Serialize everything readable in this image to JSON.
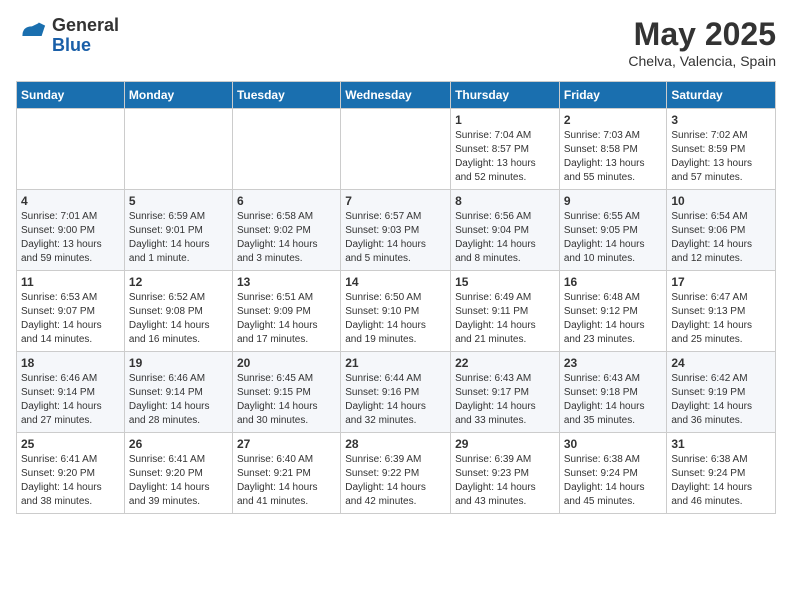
{
  "logo": {
    "general": "General",
    "blue": "Blue"
  },
  "title": "May 2025",
  "location": "Chelva, Valencia, Spain",
  "weekdays": [
    "Sunday",
    "Monday",
    "Tuesday",
    "Wednesday",
    "Thursday",
    "Friday",
    "Saturday"
  ],
  "weeks": [
    [
      {
        "day": "",
        "info": ""
      },
      {
        "day": "",
        "info": ""
      },
      {
        "day": "",
        "info": ""
      },
      {
        "day": "",
        "info": ""
      },
      {
        "day": "1",
        "info": "Sunrise: 7:04 AM\nSunset: 8:57 PM\nDaylight: 13 hours\nand 52 minutes."
      },
      {
        "day": "2",
        "info": "Sunrise: 7:03 AM\nSunset: 8:58 PM\nDaylight: 13 hours\nand 55 minutes."
      },
      {
        "day": "3",
        "info": "Sunrise: 7:02 AM\nSunset: 8:59 PM\nDaylight: 13 hours\nand 57 minutes."
      }
    ],
    [
      {
        "day": "4",
        "info": "Sunrise: 7:01 AM\nSunset: 9:00 PM\nDaylight: 13 hours\nand 59 minutes."
      },
      {
        "day": "5",
        "info": "Sunrise: 6:59 AM\nSunset: 9:01 PM\nDaylight: 14 hours\nand 1 minute."
      },
      {
        "day": "6",
        "info": "Sunrise: 6:58 AM\nSunset: 9:02 PM\nDaylight: 14 hours\nand 3 minutes."
      },
      {
        "day": "7",
        "info": "Sunrise: 6:57 AM\nSunset: 9:03 PM\nDaylight: 14 hours\nand 5 minutes."
      },
      {
        "day": "8",
        "info": "Sunrise: 6:56 AM\nSunset: 9:04 PM\nDaylight: 14 hours\nand 8 minutes."
      },
      {
        "day": "9",
        "info": "Sunrise: 6:55 AM\nSunset: 9:05 PM\nDaylight: 14 hours\nand 10 minutes."
      },
      {
        "day": "10",
        "info": "Sunrise: 6:54 AM\nSunset: 9:06 PM\nDaylight: 14 hours\nand 12 minutes."
      }
    ],
    [
      {
        "day": "11",
        "info": "Sunrise: 6:53 AM\nSunset: 9:07 PM\nDaylight: 14 hours\nand 14 minutes."
      },
      {
        "day": "12",
        "info": "Sunrise: 6:52 AM\nSunset: 9:08 PM\nDaylight: 14 hours\nand 16 minutes."
      },
      {
        "day": "13",
        "info": "Sunrise: 6:51 AM\nSunset: 9:09 PM\nDaylight: 14 hours\nand 17 minutes."
      },
      {
        "day": "14",
        "info": "Sunrise: 6:50 AM\nSunset: 9:10 PM\nDaylight: 14 hours\nand 19 minutes."
      },
      {
        "day": "15",
        "info": "Sunrise: 6:49 AM\nSunset: 9:11 PM\nDaylight: 14 hours\nand 21 minutes."
      },
      {
        "day": "16",
        "info": "Sunrise: 6:48 AM\nSunset: 9:12 PM\nDaylight: 14 hours\nand 23 minutes."
      },
      {
        "day": "17",
        "info": "Sunrise: 6:47 AM\nSunset: 9:13 PM\nDaylight: 14 hours\nand 25 minutes."
      }
    ],
    [
      {
        "day": "18",
        "info": "Sunrise: 6:46 AM\nSunset: 9:14 PM\nDaylight: 14 hours\nand 27 minutes."
      },
      {
        "day": "19",
        "info": "Sunrise: 6:46 AM\nSunset: 9:14 PM\nDaylight: 14 hours\nand 28 minutes."
      },
      {
        "day": "20",
        "info": "Sunrise: 6:45 AM\nSunset: 9:15 PM\nDaylight: 14 hours\nand 30 minutes."
      },
      {
        "day": "21",
        "info": "Sunrise: 6:44 AM\nSunset: 9:16 PM\nDaylight: 14 hours\nand 32 minutes."
      },
      {
        "day": "22",
        "info": "Sunrise: 6:43 AM\nSunset: 9:17 PM\nDaylight: 14 hours\nand 33 minutes."
      },
      {
        "day": "23",
        "info": "Sunrise: 6:43 AM\nSunset: 9:18 PM\nDaylight: 14 hours\nand 35 minutes."
      },
      {
        "day": "24",
        "info": "Sunrise: 6:42 AM\nSunset: 9:19 PM\nDaylight: 14 hours\nand 36 minutes."
      }
    ],
    [
      {
        "day": "25",
        "info": "Sunrise: 6:41 AM\nSunset: 9:20 PM\nDaylight: 14 hours\nand 38 minutes."
      },
      {
        "day": "26",
        "info": "Sunrise: 6:41 AM\nSunset: 9:20 PM\nDaylight: 14 hours\nand 39 minutes."
      },
      {
        "day": "27",
        "info": "Sunrise: 6:40 AM\nSunset: 9:21 PM\nDaylight: 14 hours\nand 41 minutes."
      },
      {
        "day": "28",
        "info": "Sunrise: 6:39 AM\nSunset: 9:22 PM\nDaylight: 14 hours\nand 42 minutes."
      },
      {
        "day": "29",
        "info": "Sunrise: 6:39 AM\nSunset: 9:23 PM\nDaylight: 14 hours\nand 43 minutes."
      },
      {
        "day": "30",
        "info": "Sunrise: 6:38 AM\nSunset: 9:24 PM\nDaylight: 14 hours\nand 45 minutes."
      },
      {
        "day": "31",
        "info": "Sunrise: 6:38 AM\nSunset: 9:24 PM\nDaylight: 14 hours\nand 46 minutes."
      }
    ]
  ]
}
